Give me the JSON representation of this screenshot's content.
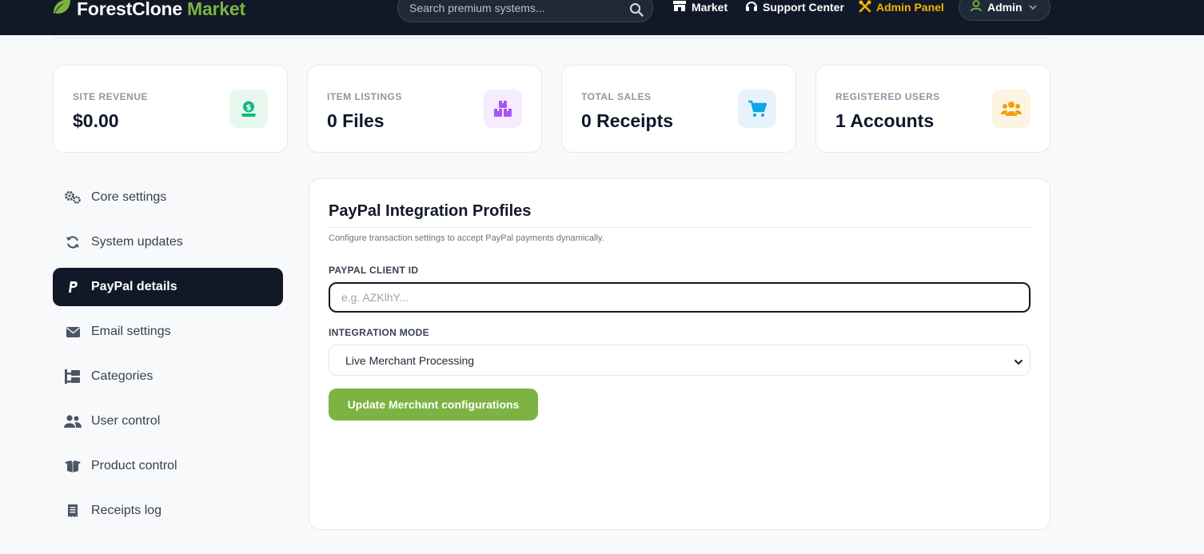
{
  "brand": {
    "part1": "ForestClone",
    "part2": "Market",
    "accent": "#7cb342"
  },
  "search": {
    "placeholder": "Search premium systems..."
  },
  "nav": {
    "market": "Market",
    "support": "Support Center",
    "admin_panel": "Admin Panel",
    "user": "Admin"
  },
  "stats": [
    {
      "label": "SITE REVENUE",
      "value": "$0.00",
      "icon": "money-icon"
    },
    {
      "label": "ITEM LISTINGS",
      "value": "0 Files",
      "icon": "boxes-icon"
    },
    {
      "label": "TOTAL SALES",
      "value": "0 Receipts",
      "icon": "cart-icon"
    },
    {
      "label": "REGISTERED USERS",
      "value": "1 Accounts",
      "icon": "users-icon"
    }
  ],
  "sidebar": {
    "items": [
      {
        "label": "Core settings",
        "icon": "gears-icon"
      },
      {
        "label": "System updates",
        "icon": "sync-icon"
      },
      {
        "label": "PayPal details",
        "icon": "paypal-icon",
        "active": true
      },
      {
        "label": "Email settings",
        "icon": "envelope-icon"
      },
      {
        "label": "Categories",
        "icon": "sitemap-icon"
      },
      {
        "label": "User control",
        "icon": "users-icon"
      },
      {
        "label": "Product control",
        "icon": "box-open-icon"
      },
      {
        "label": "Receipts log",
        "icon": "receipt-icon"
      }
    ]
  },
  "panel": {
    "title": "PayPal Integration Profiles",
    "description": "Configure transaction settings to accept PayPal payments dynamically.",
    "client_id_label": "PAYPAL CLIENT ID",
    "client_id_placeholder": "e.g. AZKlhY...",
    "client_id_value": "",
    "mode_label": "INTEGRATION MODE",
    "mode_value": "Live Merchant Processing",
    "submit_label": "Update Merchant configurations"
  }
}
